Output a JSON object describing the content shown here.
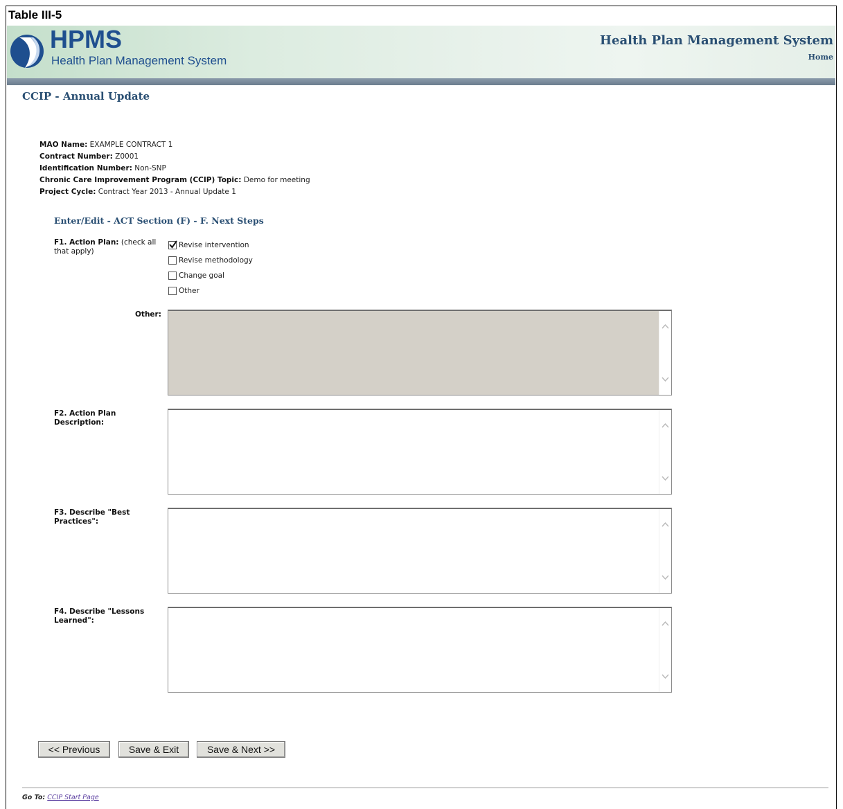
{
  "caption": "Table III-5",
  "header": {
    "logo_text": "HPMS",
    "logo_subtitle": "Health Plan Management System",
    "system_title": "Health Plan Management System",
    "home_link": "Home"
  },
  "page_title": "CCIP - Annual Update",
  "info": {
    "mao_name_label": "MAO Name:",
    "mao_name_value": "EXAMPLE CONTRACT 1",
    "contract_number_label": "Contract Number:",
    "contract_number_value": "Z0001",
    "identification_number_label": "Identification Number:",
    "identification_number_value": "Non-SNP",
    "ccip_topic_label": "Chronic Care Improvement Program (CCIP) Topic:",
    "ccip_topic_value": "Demo for meeting",
    "project_cycle_label": "Project Cycle:",
    "project_cycle_value": "Contract Year 2013 - Annual Update 1"
  },
  "section_title": "Enter/Edit - ACT Section (F) - F. Next Steps",
  "f1": {
    "label_bold": "F1. Action Plan:",
    "label_rest": "(check all",
    "label_line2": "that apply)",
    "options": [
      {
        "label": "Revise intervention",
        "checked": true
      },
      {
        "label": "Revise methodology",
        "checked": false
      },
      {
        "label": "Change goal",
        "checked": false
      },
      {
        "label": "Other",
        "checked": false
      }
    ]
  },
  "other_label": "Other:",
  "f2": {
    "line1": "F2. Action Plan",
    "line2": "Description:"
  },
  "f3": {
    "line1": "F3. Describe \"Best",
    "line2": "Practices\":"
  },
  "f4": {
    "line1": "F4. Describe \"Lessons",
    "line2": "Learned\":"
  },
  "buttons": {
    "previous": "<< Previous",
    "save_exit": "Save & Exit",
    "save_next": "Save & Next >>"
  },
  "footer": {
    "goto_label": "Go To:",
    "goto_link": "CCIP Start Page"
  }
}
